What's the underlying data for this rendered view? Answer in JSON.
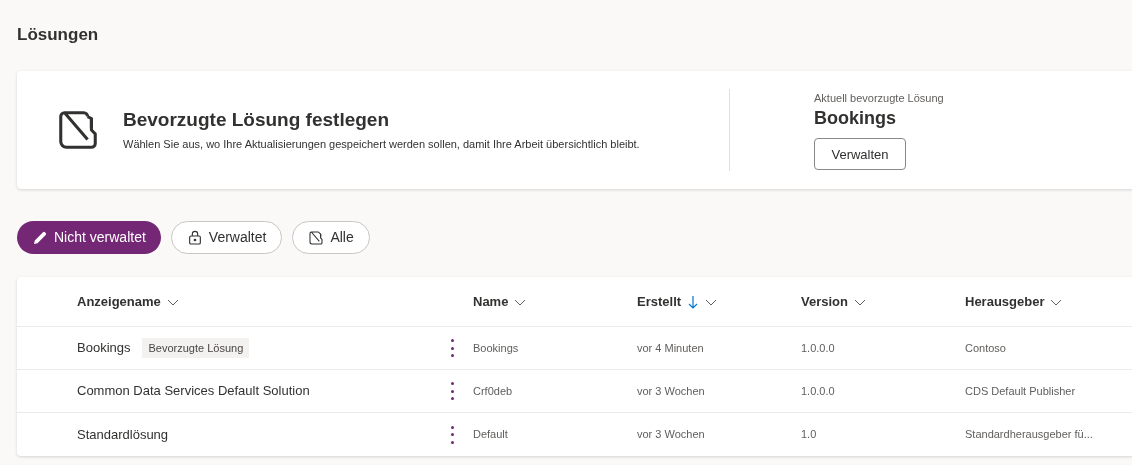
{
  "page_title": "Lösungen",
  "preferred_card": {
    "title": "Bevorzugte Lösung festlegen",
    "description": "Wählen Sie aus, wo Ihre Aktualisierungen gespeichert werden sollen, damit Ihre Arbeit übersichtlich bleibt.",
    "current_label": "Aktuell bevorzugte Lösung",
    "current_value": "Bookings",
    "button": "Verwalten"
  },
  "filters": [
    {
      "label": "Nicht verwaltet",
      "kind": "pencil",
      "selected": true
    },
    {
      "label": "Verwaltet",
      "kind": "lock",
      "selected": false
    },
    {
      "label": "Alle",
      "kind": "folder",
      "selected": false
    }
  ],
  "table": {
    "columns": [
      {
        "label": "Anzeigename",
        "sorted": false
      },
      {
        "label": "Name",
        "sorted": false
      },
      {
        "label": "Erstellt",
        "sorted": true
      },
      {
        "label": "Version",
        "sorted": false
      },
      {
        "label": "Herausgeber",
        "sorted": false
      }
    ],
    "rows": [
      {
        "display_name": "Bookings",
        "badge": "Bevorzugte Lösung",
        "name": "Bookings",
        "created": "vor 4 Minuten",
        "version": "1.0.0.0",
        "publisher": "Contoso"
      },
      {
        "display_name": "Common Data Services Default Solution",
        "name": "Crf0deb",
        "created": "vor 3 Wochen",
        "version": "1.0.0.0",
        "publisher": "CDS Default Publisher"
      },
      {
        "display_name": "Standardlösung",
        "name": "Default",
        "created": "vor 3 Wochen",
        "version": "1.0",
        "publisher": "Standardherausgeber fü..."
      }
    ]
  }
}
